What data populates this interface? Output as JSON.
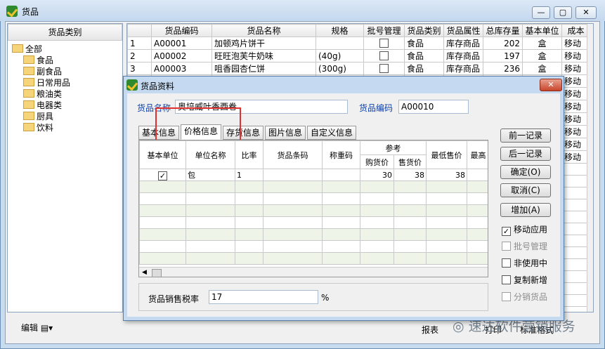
{
  "window": {
    "title": "货品",
    "controls": [
      "—",
      "▢",
      "✕"
    ]
  },
  "tree": {
    "header": "货品类别",
    "root": "全部",
    "children": [
      "食品",
      "副食品",
      "日常用品",
      "粮油类",
      "电器类",
      "厨具",
      "饮料"
    ]
  },
  "grid": {
    "columns": [
      "",
      "货品编码",
      "货品名称",
      "规格",
      "批号管理",
      "货品类别",
      "货品属性",
      "总库存量",
      "基本单位",
      "成本"
    ],
    "rows": [
      [
        "1",
        "A00001",
        "加顿鸡片饼干",
        "",
        "",
        "食品",
        "库存商品",
        "202",
        "盒",
        "移动"
      ],
      [
        "2",
        "A00002",
        "旺旺泡芙牛奶味",
        "(40g)",
        "",
        "食品",
        "库存商品",
        "197",
        "盒",
        "移动"
      ],
      [
        "3",
        "A00003",
        "咀香园杏仁饼",
        "(300g)",
        "",
        "食品",
        "库存商品",
        "236",
        "盒",
        "移动"
      ]
    ],
    "extra_cost_cells": [
      "移动",
      "移动",
      "移动",
      "移动",
      "移动",
      "移动",
      "移动"
    ]
  },
  "bottom": {
    "edit_label": "编辑",
    "report_label": "报表",
    "print_label": "打印",
    "standard_label": "标准格式",
    "watermark": "速达软件营销服务"
  },
  "dialog": {
    "title": "货品资料",
    "name_label": "货品名称",
    "name_value": "奥培威叶香西卷",
    "code_label": "货品编码",
    "code_value": "A00010",
    "tabs": [
      "基本信息",
      "价格信息",
      "存货信息",
      "图片信息",
      "自定义信息"
    ],
    "active_tab": "价格信息",
    "price_table": {
      "headers": [
        "基本单位",
        "单位名称",
        "比率",
        "货品条码",
        "称重码",
        "参考",
        "最低售价",
        "最高"
      ],
      "sub_headers": [
        "购货价",
        "售货价"
      ],
      "row": {
        "is_base": true,
        "unit": "包",
        "ratio": "1",
        "barcode": "",
        "weigh": "",
        "purchase": "30",
        "sale": "38",
        "min": "38",
        "max": ""
      }
    },
    "tax_label": "货品销售税率",
    "tax_value": "17",
    "tax_unit": "%",
    "buttons": [
      "前一记录",
      "后一记录",
      "确定(O)",
      "取消(C)",
      "增加(A)"
    ],
    "checks": [
      {
        "label": "移动应用",
        "checked": true,
        "disabled": false
      },
      {
        "label": "批号管理",
        "checked": false,
        "disabled": true
      },
      {
        "label": "非使用中",
        "checked": false,
        "disabled": false
      },
      {
        "label": "复制新增",
        "checked": false,
        "disabled": false
      },
      {
        "label": "分销货品",
        "checked": false,
        "disabled": true
      }
    ],
    "close": "✕"
  },
  "colors": {
    "highlight": "#e03131",
    "dialog_title_bg": "#c5d9f0",
    "alt_row": "#eef5e8"
  }
}
